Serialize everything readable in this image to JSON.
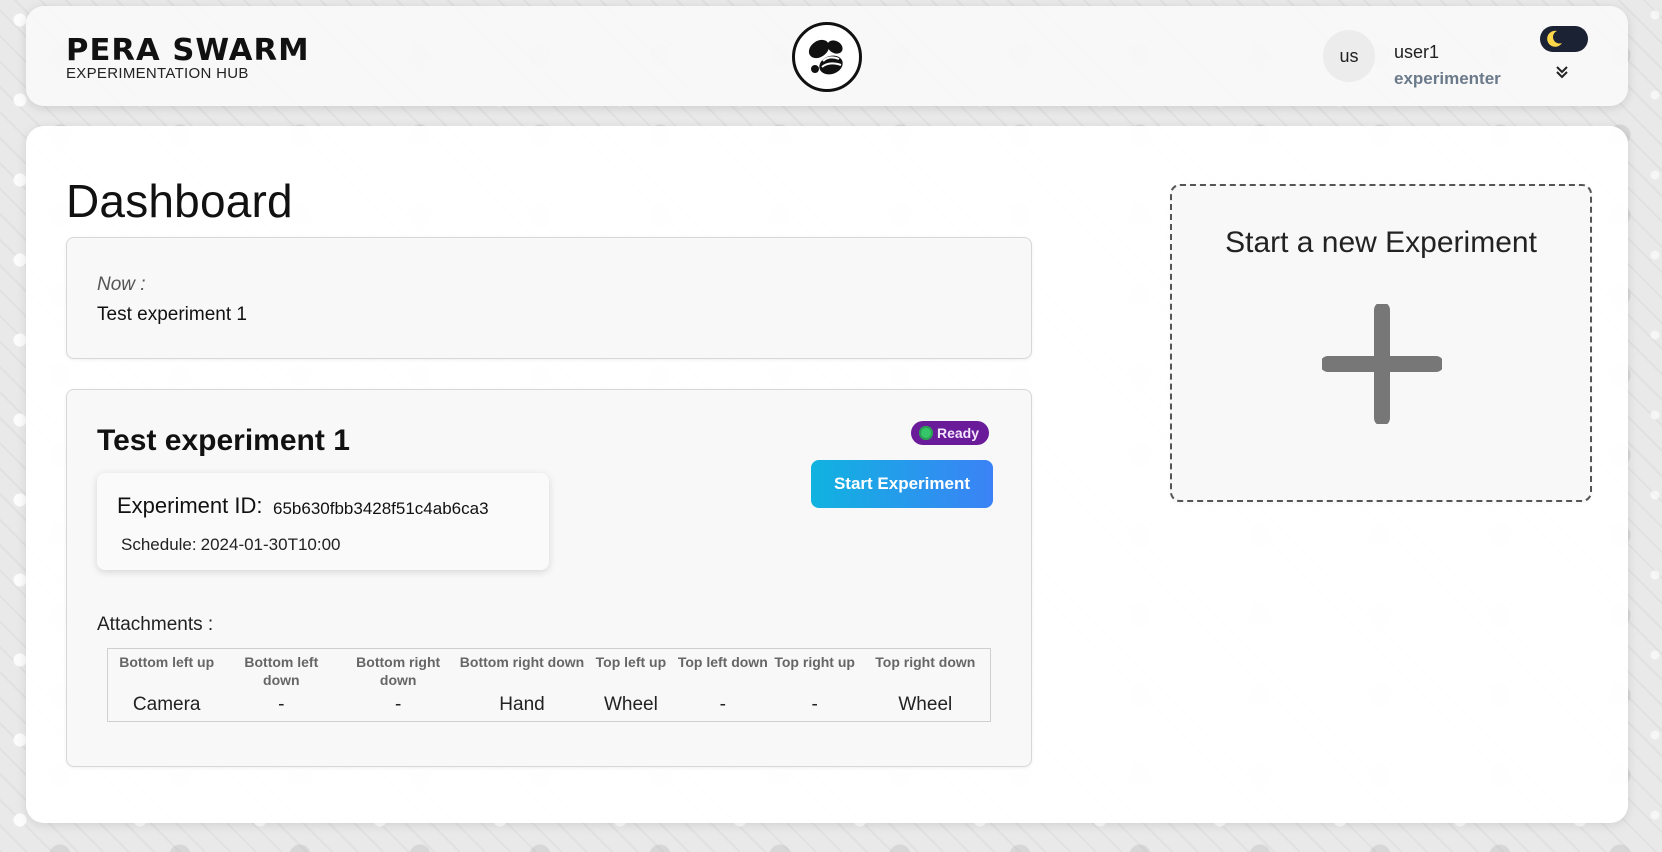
{
  "header": {
    "brand_name": "PERA SWARM",
    "brand_subtitle": "EXPERIMENTATION HUB",
    "logo_icon": "bee-icon",
    "avatar_initials": "us",
    "user_name": "user1",
    "user_role": "experimenter",
    "theme_icon": "moon-icon",
    "menu_icon": "double-chevron-down-icon"
  },
  "main": {
    "title": "Dashboard",
    "now_card": {
      "label": "Now :",
      "value": "Test experiment 1"
    },
    "experiment_card": {
      "title": "Test experiment 1",
      "status": "Ready",
      "status_color": "#6a1b9a",
      "start_button": "Start Experiment",
      "id_label": "Experiment ID:",
      "id_value": "65b630fbb3428f51c4ab6ca3",
      "schedule_label": "Schedule:",
      "schedule_value": "2024-01-30T10:00",
      "attachments_label": "Attachments :",
      "attachments": {
        "headers": [
          "Bottom left up",
          "Bottom left down",
          "Bottom right down",
          "Bottom right down",
          "Top left up",
          "Top left down",
          "Top right up",
          "Top right down"
        ],
        "values": [
          "Camera",
          "-",
          "-",
          "Hand",
          "Wheel",
          "-",
          "-",
          "Wheel"
        ]
      }
    },
    "new_experiment": {
      "title": "Start a new Experiment",
      "icon": "plus-icon"
    }
  },
  "colors": {
    "accent_gradient_start": "#10b3e0",
    "accent_gradient_end": "#3b82f6",
    "ready_dot": "#37c56a"
  }
}
